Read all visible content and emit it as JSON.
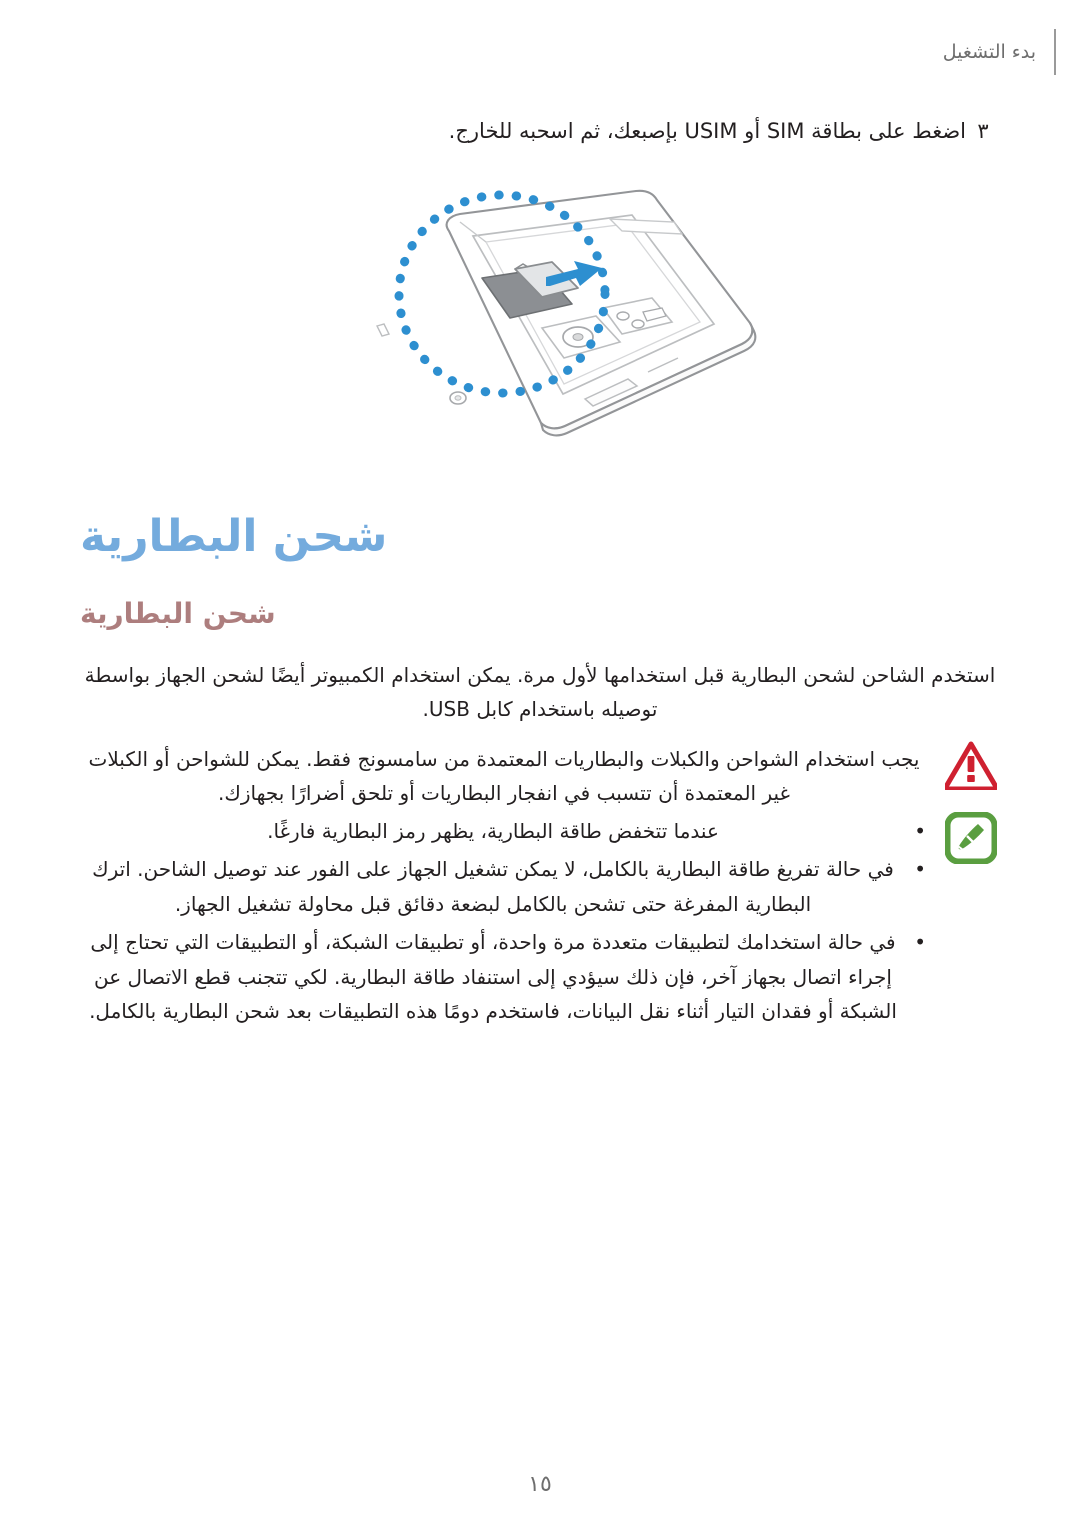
{
  "header": {
    "title": "بدء التشغيل"
  },
  "step": {
    "number": "٣",
    "text": "اضغط على بطاقة SIM أو USIM بإصبعك، ثم اسحبه للخارج."
  },
  "illustration": {
    "name": "phone-sim-card-removal-diagram",
    "highlight_color": "#2d8fd0",
    "arrow_color": "#2d8fd0",
    "outline_color": "#939598"
  },
  "headings": {
    "h1": "شحن البطارية",
    "h1_color": "#74abdd",
    "h2": "شحن البطارية",
    "h2_color": "#ad7e7e"
  },
  "body": {
    "paragraph": "استخدم الشاحن لشحن البطارية قبل استخدامها لأول مرة. يمكن استخدام الكمبيوتر أيضًا لشحن الجهاز بواسطة توصيله باستخدام كابل USB."
  },
  "warning": {
    "icon": "warning-triangle-icon",
    "icon_color": "#cf2030",
    "text": "يجب استخدام الشواحن والكبلات والبطاريات المعتمدة من سامسونج فقط. يمكن للشواحن أو الكبلات غير المعتمدة أن تتسبب في انفجار البطاريات أو تلحق أضرارًا بجهازك."
  },
  "note": {
    "icon": "note-pencil-icon",
    "icon_color": "#5a9e40",
    "items": [
      "عندما تتخفض طاقة البطارية، يظهر رمز البطارية فارغًا.",
      "في حالة تفريغ طاقة البطارية بالكامل، لا يمكن تشغيل الجهاز على الفور عند توصيل الشاحن. اترك البطارية المفرغة حتى تشحن بالكامل لبضعة دقائق قبل محاولة تشغيل الجهاز.",
      "في حالة استخدامك لتطبيقات متعددة مرة واحدة، أو تطبيقات الشبكة، أو التطبيقات التي تحتاج إلى إجراء اتصال بجهاز آخر، فإن ذلك سيؤدي إلى استنفاد طاقة البطارية. لكي تتجنب قطع الاتصال عن الشبكة أو فقدان التيار أثناء نقل البيانات، فاستخدم دومًا هذه التطبيقات بعد شحن البطارية بالكامل."
    ]
  },
  "footer": {
    "page_number": "١٥"
  }
}
